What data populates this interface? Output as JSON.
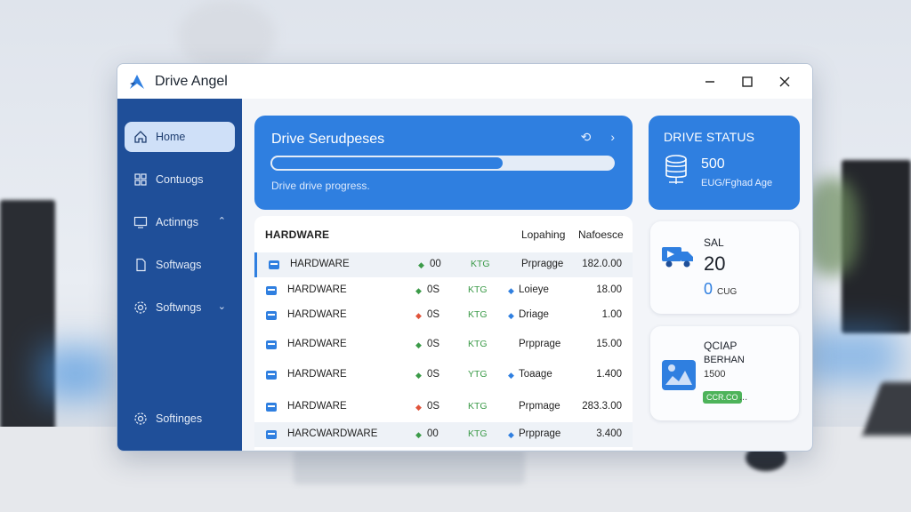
{
  "window": {
    "title": "Drive Angel"
  },
  "sidebar": {
    "items": [
      {
        "label": "Home"
      },
      {
        "label": "Contuogs"
      },
      {
        "label": "Actinngs"
      },
      {
        "label": "Softwags"
      },
      {
        "label": "Softwngs"
      },
      {
        "label": "Softinges"
      }
    ]
  },
  "progress": {
    "title": "Drive Serudpeses",
    "subtitle": "Drive drive progress.",
    "value_fraction": 0.68
  },
  "drive_status": {
    "title": "DRIVE STATUS",
    "value": "500",
    "subtitle": "EUG/Fghad Age"
  },
  "table": {
    "title": "HARDWARE",
    "columns": [
      "Lopahing",
      "Nafoesce"
    ],
    "rows": [
      {
        "name": "HARDWARE",
        "dot": "green",
        "v1": "00",
        "ktg": "KTG",
        "type": "Prpragge",
        "num": "182.0.00"
      },
      {
        "name": "HARDWARE",
        "dot": "green",
        "v1": "0S",
        "ktg": "KTG",
        "type": "Loieye",
        "num": "18.00"
      },
      {
        "name": "HARDWARE",
        "dot": "red",
        "v1": "0S",
        "ktg": "KTG",
        "type": "Driage",
        "num": "1.00"
      },
      {
        "name": "HARDWARE",
        "dot": "green",
        "v1": "0S",
        "ktg": "KTG",
        "type": "Prpprage",
        "num": "15.00"
      },
      {
        "name": "HARDWARE",
        "dot": "green",
        "v1": "0S",
        "ktg": "YTG",
        "type": "Toaage",
        "num": "1.400"
      },
      {
        "name": "HARDWARE",
        "dot": "red",
        "v1": "0S",
        "ktg": "KTG",
        "type": "Prpmage",
        "num": "283.3.00"
      },
      {
        "name": "HARCWARDWARE",
        "dot": "green",
        "v1": "00",
        "ktg": "KTG",
        "type": "Prpprage",
        "num": "3.400"
      }
    ]
  },
  "card_sal": {
    "label": "SAL",
    "value": "20",
    "sub_num": "0",
    "sub_text": "CUG"
  },
  "card_qciap": {
    "label1": "QCIAP",
    "label2": "BERHAN",
    "num": "1500",
    "badge": "CCR.CO",
    "more": "..."
  },
  "colors": {
    "accent": "#2f7fe0",
    "sidebar": "#1f4f99",
    "ok": "#3b9a48",
    "error": "#e0533a"
  }
}
